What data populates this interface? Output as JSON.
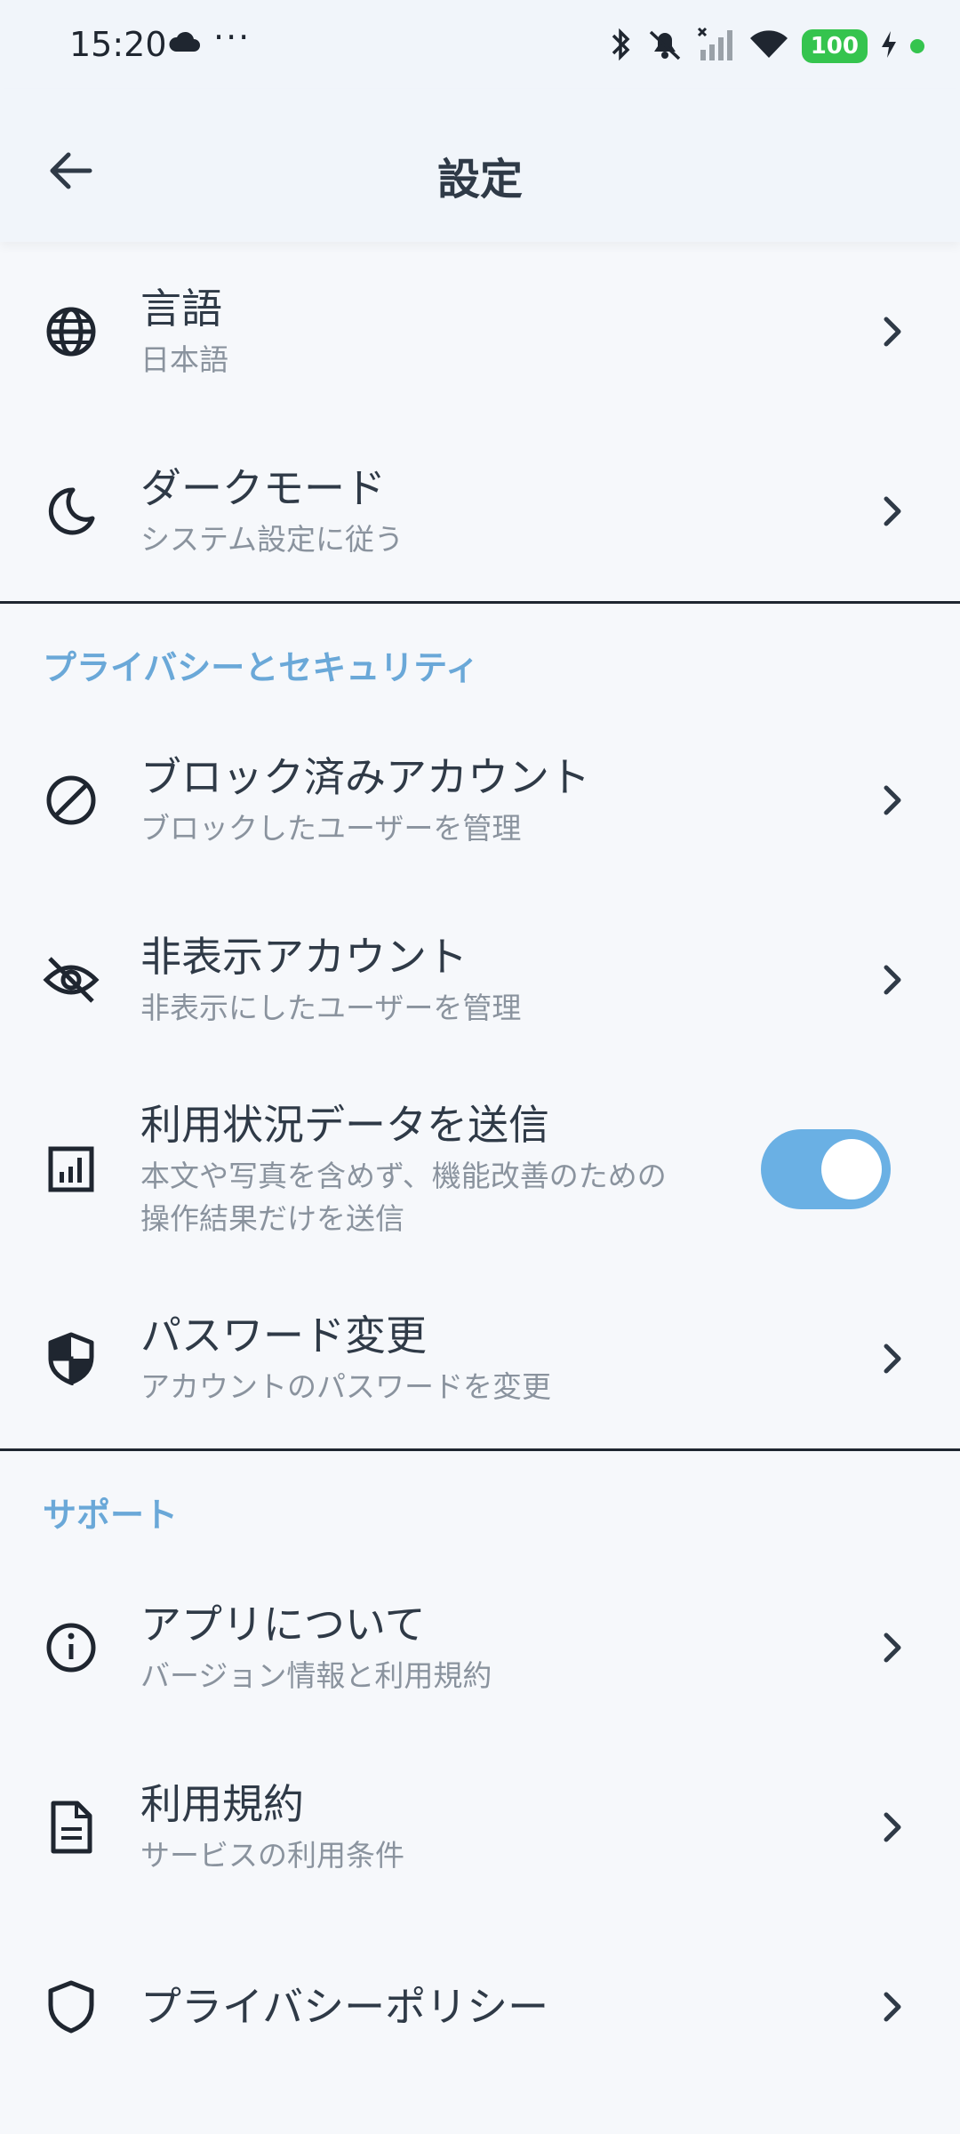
{
  "status_bar": {
    "time": "15:20",
    "battery": "100"
  },
  "app_bar": {
    "title": "設定"
  },
  "general": {
    "items": [
      {
        "title": "言語",
        "subtitle": "日本語"
      },
      {
        "title": "ダークモード",
        "subtitle": "システム設定に従う"
      }
    ]
  },
  "privacy": {
    "header": "プライバシーとセキュリティ",
    "items": [
      {
        "title": "ブロック済みアカウント",
        "subtitle": "ブロックしたユーザーを管理"
      },
      {
        "title": "非表示アカウント",
        "subtitle": "非表示にしたユーザーを管理"
      },
      {
        "title": "利用状況データを送信",
        "subtitle_line1": "本文や写真を含めず、機能改善のための",
        "subtitle_line2": "操作結果だけを送信"
      },
      {
        "title": "パスワード変更",
        "subtitle": "アカウントのパスワードを変更"
      }
    ]
  },
  "support": {
    "header": "サポート",
    "items": [
      {
        "title": "アプリについて",
        "subtitle": "バージョン情報と利用規約"
      },
      {
        "title": "利用規約",
        "subtitle": "サービスの利用条件"
      },
      {
        "title": "プライバシーポリシー",
        "subtitle": ""
      }
    ]
  },
  "colors": {
    "accent": "#6ab0e4",
    "section_header": "#6aa8d8",
    "battery": "#35c44e"
  }
}
